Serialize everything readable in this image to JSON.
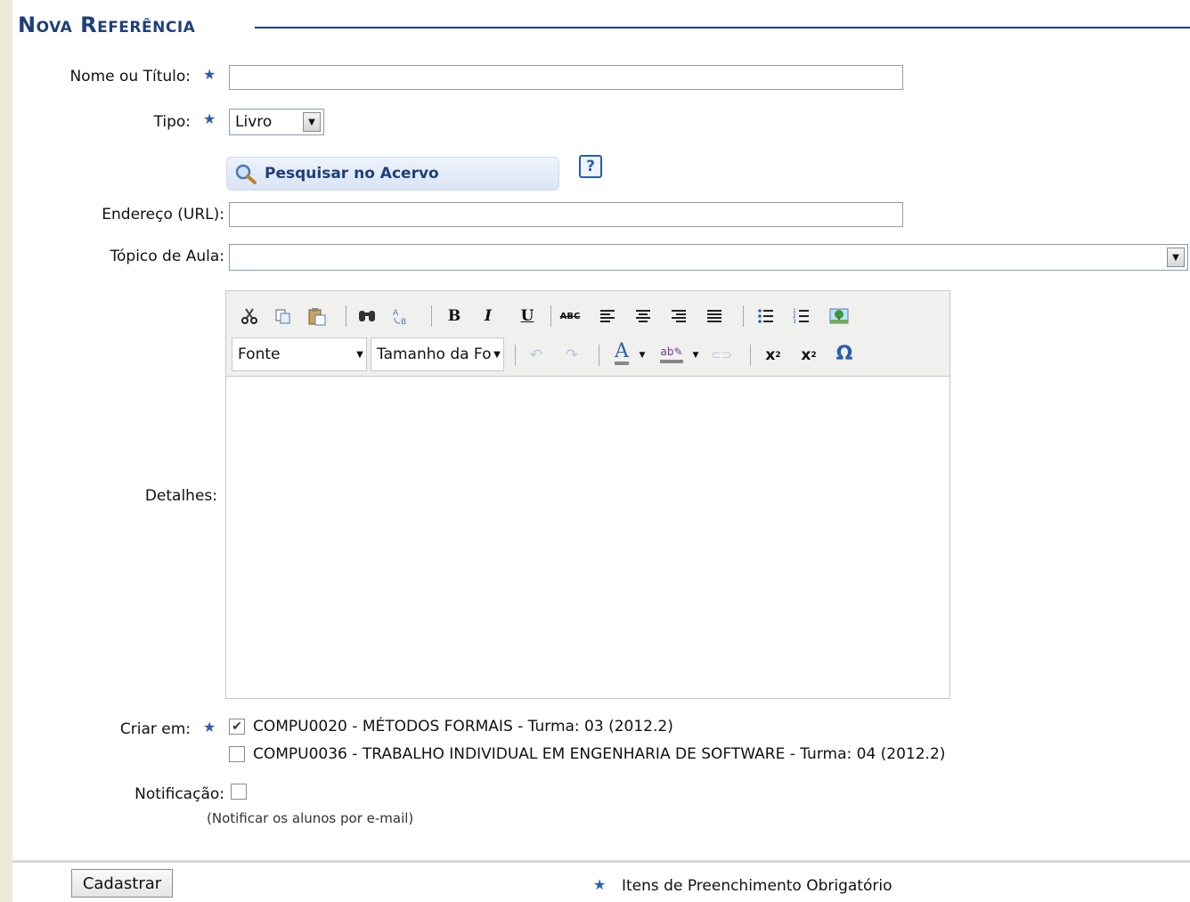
{
  "form": {
    "heading": "Nova Referência",
    "nome_label": "Nome ou Título:",
    "nome_value": "",
    "tipo_label": "Tipo:",
    "tipo_value": "Livro",
    "search_button": "Pesquisar no Acervo",
    "help_icon": "?",
    "url_label": "Endereço (URL):",
    "url_value": "",
    "topico_label": "Tópico de Aula:",
    "topico_value": "",
    "detalhes_label": "Detalhes:",
    "criar_em_label": "Criar em:",
    "turmas": [
      {
        "label": "COMPU0020 - MÉTODOS FORMAIS - Turma: 03 (2012.2)",
        "checked": true
      },
      {
        "label": "COMPU0036 - TRABALHO INDIVIDUAL EM ENGENHARIA DE SOFTWARE - Turma: 04 (2012.2)",
        "checked": false
      }
    ],
    "notificacao_label": "Notificação:",
    "notificacao_checked": false,
    "notificacao_hint": "(Notificar os alunos por e-mail)",
    "submit_label": "Cadastrar",
    "required_legend": "Itens de Preenchimento Obrigatório",
    "required_marker": "★"
  },
  "editor": {
    "font_select": "Fonte",
    "size_select": "Tamanho da Fonte",
    "toolbar_icons": [
      "cut-icon",
      "copy-icon",
      "paste-icon",
      "find-icon",
      "replace-icon",
      "bold-icon",
      "italic-icon",
      "underline-icon",
      "spellcheck-icon",
      "align-left-icon",
      "align-center-icon",
      "align-right-icon",
      "align-justify-icon",
      "bullet-list-icon",
      "numbered-list-icon",
      "image-icon",
      "undo-icon",
      "redo-icon",
      "font-color-icon",
      "highlight-icon",
      "link-icon",
      "subscript-icon",
      "superscript-icon",
      "special-char-icon"
    ],
    "content": ""
  },
  "colors": {
    "heading": "#1f3f7a",
    "required_star": "#2a5db0"
  }
}
